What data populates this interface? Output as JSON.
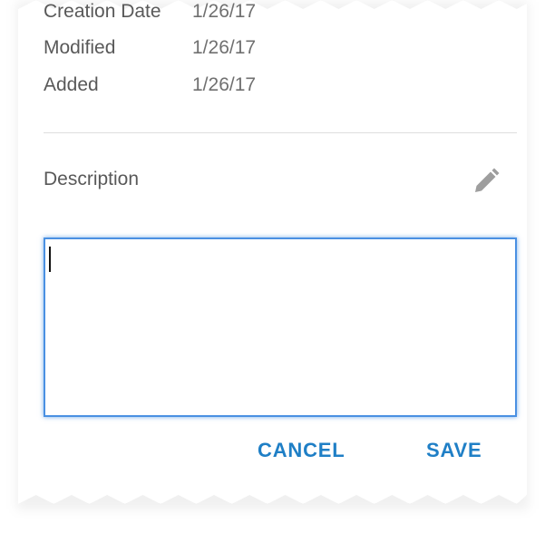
{
  "metadata": [
    {
      "label": "Creation Date",
      "value": "1/26/17"
    },
    {
      "label": "Modified",
      "value": "1/26/17"
    },
    {
      "label": "Added",
      "value": "1/26/17"
    }
  ],
  "description": {
    "label": "Description",
    "value": "",
    "placeholder": "",
    "edit_icon": "pencil-icon"
  },
  "actions": {
    "cancel_label": "CANCEL",
    "save_label": "SAVE"
  },
  "colors": {
    "accent": "#1f7fc6",
    "focus_border": "#4a90e2",
    "label_text": "#595959",
    "value_text": "#707070",
    "icon": "#9e9e9e"
  }
}
